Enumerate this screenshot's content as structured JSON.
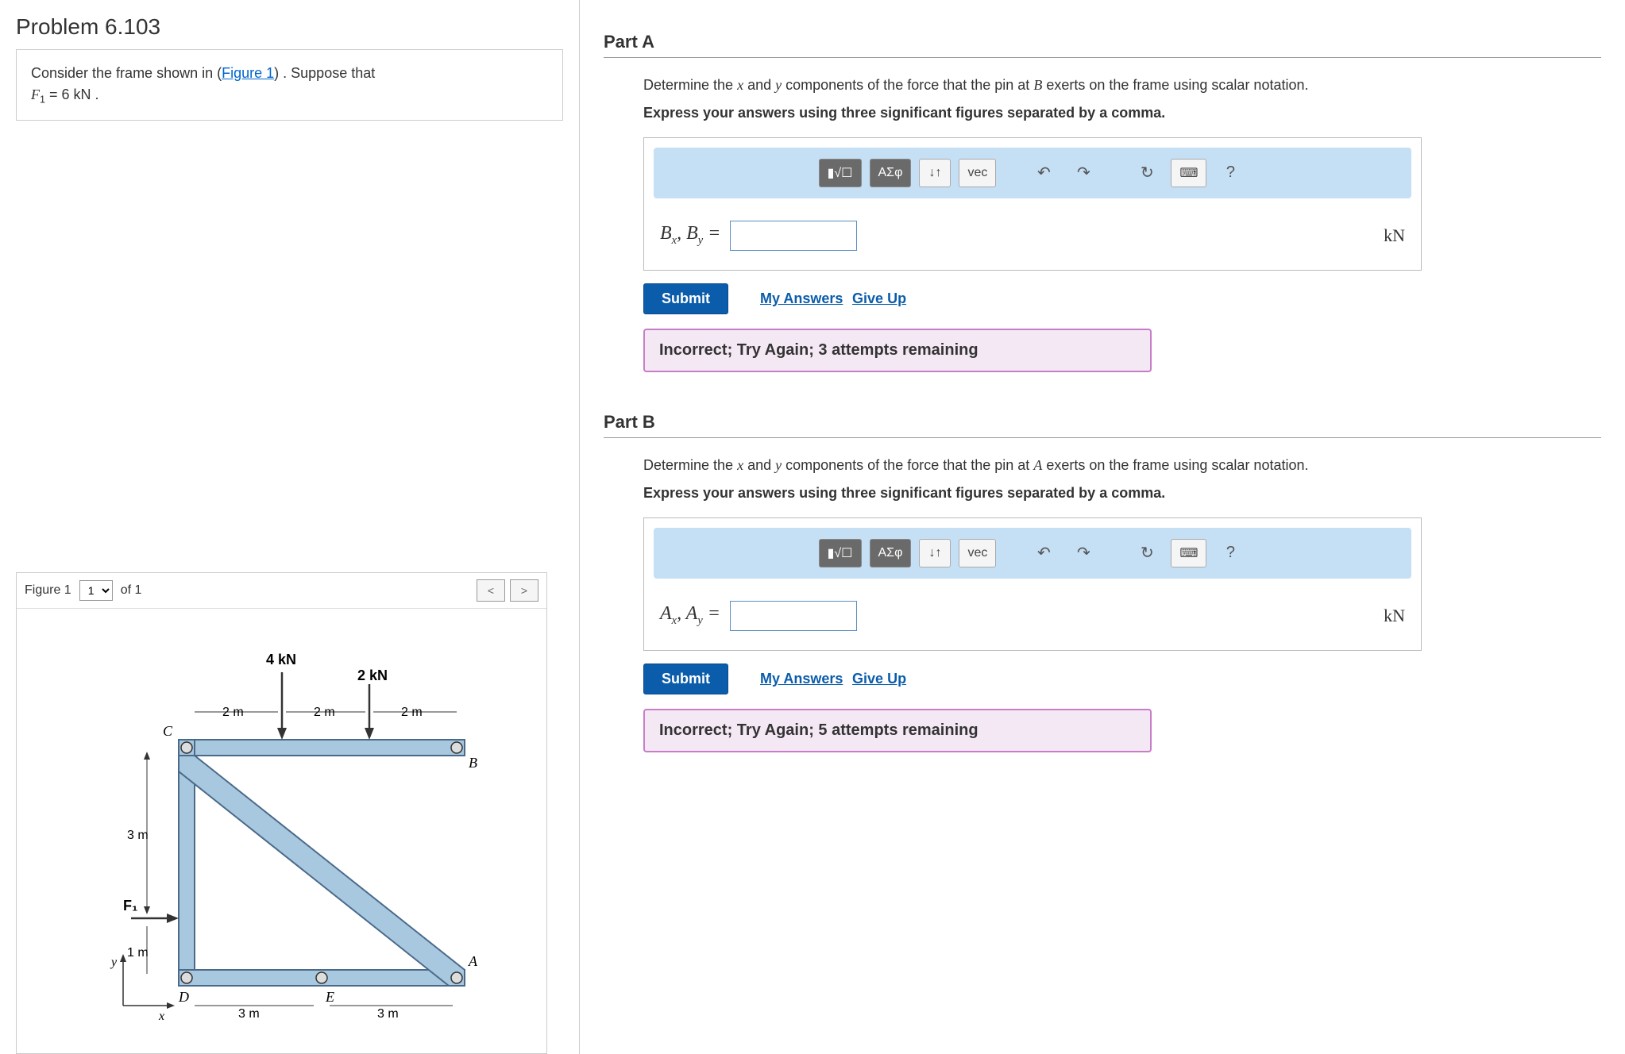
{
  "problem": {
    "title": "Problem 6.103",
    "intro_pre": "Consider the frame shown in (",
    "figure_link": "Figure 1",
    "intro_post": ") . Suppose that ",
    "given_var": "F",
    "given_sub": "1",
    "given_eq": " = 6  kN ."
  },
  "figure": {
    "label": "Figure 1",
    "selector_value": "1",
    "of_text": "of 1"
  },
  "parts": [
    {
      "title": "Part A",
      "desc_pre": "Determine the ",
      "var1": "x",
      "desc_mid": " and ",
      "var2": "y",
      "desc_mid2": " components of the force that the pin at ",
      "pin": "B",
      "desc_post": " exerts on the frame using scalar notation.",
      "instruction": "Express your answers using three significant figures separated by a comma.",
      "var_label_html": "B<sub>x</sub>, B<sub>y</sub> =",
      "unit": "kN",
      "input_value": "",
      "submit": "Submit",
      "my_answers": "My Answers",
      "give_up": "Give Up",
      "feedback": "Incorrect; Try Again; 3 attempts remaining"
    },
    {
      "title": "Part B",
      "desc_pre": "Determine the ",
      "var1": "x",
      "desc_mid": " and ",
      "var2": "y",
      "desc_mid2": " components of the force that the pin at ",
      "pin": "A",
      "desc_post": " exerts on the frame using scalar notation.",
      "instruction": "Express your answers using three significant figures separated by a comma.",
      "var_label_html": "A<sub>x</sub>, A<sub>y</sub> =",
      "unit": "kN",
      "input_value": "",
      "submit": "Submit",
      "my_answers": "My Answers",
      "give_up": "Give Up",
      "feedback": "Incorrect; Try Again; 5 attempts remaining"
    }
  ],
  "toolbar": {
    "template": "▮√☐",
    "greek": "ΑΣφ",
    "subscript": "↓↑",
    "vec": "vec",
    "undo": "↶",
    "redo": "↷",
    "reset": "↻",
    "keyboard": "⌨",
    "help": "?"
  },
  "diagram": {
    "force_4kn": "4 kN",
    "force_2kn": "2 kN",
    "dim_2m": "2 m",
    "dim_3m_v": "3 m",
    "dim_1m": "1 m",
    "dim_3m_h": "3 m",
    "label_C": "C",
    "label_B": "B",
    "label_A": "A",
    "label_D": "D",
    "label_E": "E",
    "label_F1": "F₁",
    "label_x": "x",
    "label_y": "y"
  }
}
